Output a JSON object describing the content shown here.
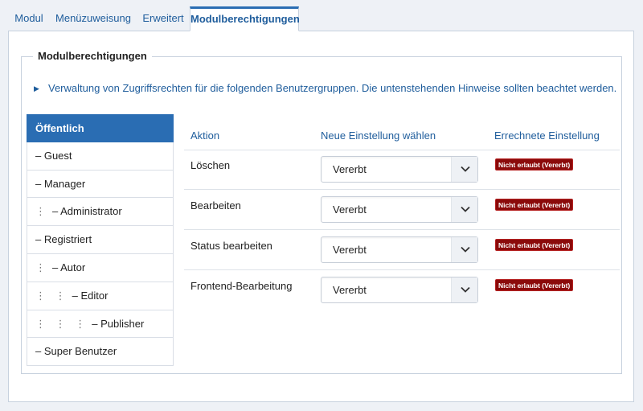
{
  "tabs": [
    {
      "label": "Modul",
      "active": false
    },
    {
      "label": "Menüzuweisung",
      "active": false
    },
    {
      "label": "Erweitert",
      "active": false
    },
    {
      "label": "Modulberechtigungen",
      "active": true
    }
  ],
  "fieldset": {
    "legend": "Modulberechtigungen",
    "info": "Verwaltung von Zugriffsrechten für die folgenden Benutzergruppen. Die untenstehenden Hinweise sollten beachtet werden."
  },
  "groups": [
    {
      "dots": "",
      "label": "Öffentlich",
      "active": true
    },
    {
      "dots": "",
      "label": "– Guest"
    },
    {
      "dots": "",
      "label": "– Manager"
    },
    {
      "dots": "⋮",
      "label": "– Administrator"
    },
    {
      "dots": "",
      "label": "– Registriert"
    },
    {
      "dots": "⋮",
      "label": "– Autor"
    },
    {
      "dots": "⋮ ⋮",
      "label": "– Editor"
    },
    {
      "dots": "⋮ ⋮ ⋮",
      "label": "– Publisher"
    },
    {
      "dots": "",
      "label": "– Super Benutzer"
    }
  ],
  "table": {
    "headers": {
      "action": "Aktion",
      "new_setting": "Neue Einstellung wählen",
      "calculated": "Errechnete Einstellung"
    },
    "rows": [
      {
        "action": "Löschen",
        "select": "Vererbt",
        "calculated": "Nicht erlaubt (Vererbt)"
      },
      {
        "action": "Bearbeiten",
        "select": "Vererbt",
        "calculated": "Nicht erlaubt (Vererbt)"
      },
      {
        "action": "Status bearbeiten",
        "select": "Vererbt",
        "calculated": "Nicht erlaubt (Vererbt)"
      },
      {
        "action": "Frontend-Bearbeitung",
        "select": "Vererbt",
        "calculated": "Nicht erlaubt (Vererbt)"
      }
    ]
  },
  "colors": {
    "accent": "#2a6db3",
    "link": "#1f5d9c",
    "badge": "#8b0a0a"
  },
  "icons": {
    "select_arrow": "chevron-down-icon",
    "info_arrow": "caret-right-icon"
  }
}
